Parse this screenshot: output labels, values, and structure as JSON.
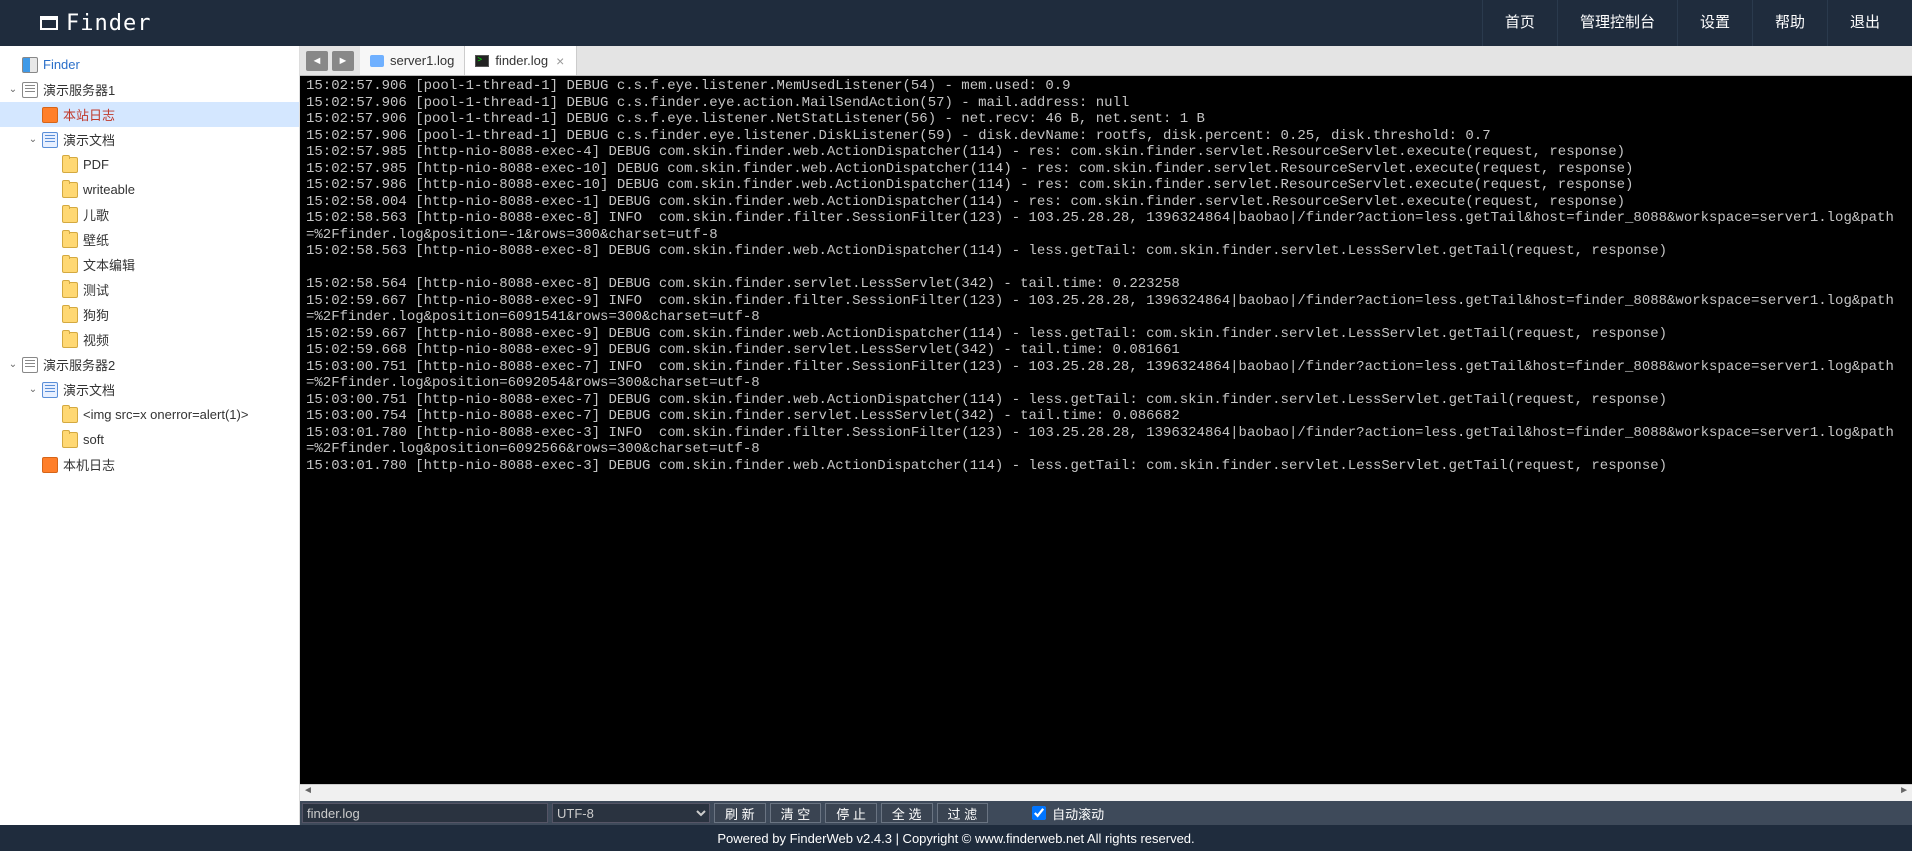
{
  "brand": "Finder",
  "nav": [
    "首页",
    "管理控制台",
    "设置",
    "帮助",
    "退出"
  ],
  "tree": [
    {
      "depth": 0,
      "toggle": "",
      "icon": "finder",
      "label": "Finder",
      "root": true
    },
    {
      "depth": 0,
      "toggle": "v",
      "icon": "page",
      "label": "演示服务器1"
    },
    {
      "depth": 1,
      "toggle": "",
      "icon": "log",
      "label": "本站日志",
      "active": true
    },
    {
      "depth": 1,
      "toggle": "v",
      "icon": "doc",
      "label": "演示文档"
    },
    {
      "depth": 2,
      "toggle": "",
      "icon": "folder",
      "label": "PDF"
    },
    {
      "depth": 2,
      "toggle": "",
      "icon": "folder",
      "label": "writeable"
    },
    {
      "depth": 2,
      "toggle": "",
      "icon": "folder",
      "label": "儿歌"
    },
    {
      "depth": 2,
      "toggle": "",
      "icon": "folder",
      "label": "壁纸"
    },
    {
      "depth": 2,
      "toggle": "",
      "icon": "folder",
      "label": "文本编辑"
    },
    {
      "depth": 2,
      "toggle": "",
      "icon": "folder",
      "label": "测试"
    },
    {
      "depth": 2,
      "toggle": "",
      "icon": "folder",
      "label": "狗狗"
    },
    {
      "depth": 2,
      "toggle": "",
      "icon": "folder",
      "label": "视频"
    },
    {
      "depth": 0,
      "toggle": "v",
      "icon": "page",
      "label": "演示服务器2"
    },
    {
      "depth": 1,
      "toggle": "v",
      "icon": "doc",
      "label": "演示文档"
    },
    {
      "depth": 2,
      "toggle": "",
      "icon": "folder",
      "label": "<img src=x onerror=alert(1)>"
    },
    {
      "depth": 2,
      "toggle": "",
      "icon": "folder",
      "label": "soft"
    },
    {
      "depth": 1,
      "toggle": "",
      "icon": "log",
      "label": "本机日志"
    }
  ],
  "tabs": [
    {
      "icon": "folder",
      "label": "server1.log",
      "close": false,
      "active": false
    },
    {
      "icon": "term",
      "label": "finder.log",
      "close": true,
      "active": true
    }
  ],
  "log_lines": [
    "15:02:57.906 [pool-1-thread-1] DEBUG c.s.f.eye.listener.MemUsedListener(54) - mem.used: 0.9",
    "15:02:57.906 [pool-1-thread-1] DEBUG c.s.finder.eye.action.MailSendAction(57) - mail.address: null",
    "15:02:57.906 [pool-1-thread-1] DEBUG c.s.f.eye.listener.NetStatListener(56) - net.recv: 46 B, net.sent: 1 B",
    "15:02:57.906 [pool-1-thread-1] DEBUG c.s.finder.eye.listener.DiskListener(59) - disk.devName: rootfs, disk.percent: 0.25, disk.threshold: 0.7",
    "15:02:57.985 [http-nio-8088-exec-4] DEBUG com.skin.finder.web.ActionDispatcher(114) - res: com.skin.finder.servlet.ResourceServlet.execute(request, response)",
    "15:02:57.985 [http-nio-8088-exec-10] DEBUG com.skin.finder.web.ActionDispatcher(114) - res: com.skin.finder.servlet.ResourceServlet.execute(request, response)",
    "15:02:57.986 [http-nio-8088-exec-10] DEBUG com.skin.finder.web.ActionDispatcher(114) - res: com.skin.finder.servlet.ResourceServlet.execute(request, response)",
    "15:02:58.004 [http-nio-8088-exec-1] DEBUG com.skin.finder.web.ActionDispatcher(114) - res: com.skin.finder.servlet.ResourceServlet.execute(request, response)",
    "15:02:58.563 [http-nio-8088-exec-8] INFO  com.skin.finder.filter.SessionFilter(123) - 103.25.28.28, 1396324864|baobao|/finder?action=less.getTail&host=finder_8088&workspace=server1.log&path=%2Ffinder.log&position=-1&rows=300&charset=utf-8",
    "15:02:58.563 [http-nio-8088-exec-8] DEBUG com.skin.finder.web.ActionDispatcher(114) - less.getTail: com.skin.finder.servlet.LessServlet.getTail(request, response)",
    "",
    "15:02:58.564 [http-nio-8088-exec-8] DEBUG com.skin.finder.servlet.LessServlet(342) - tail.time: 0.223258",
    "15:02:59.667 [http-nio-8088-exec-9] INFO  com.skin.finder.filter.SessionFilter(123) - 103.25.28.28, 1396324864|baobao|/finder?action=less.getTail&host=finder_8088&workspace=server1.log&path=%2Ffinder.log&position=6091541&rows=300&charset=utf-8",
    "15:02:59.667 [http-nio-8088-exec-9] DEBUG com.skin.finder.web.ActionDispatcher(114) - less.getTail: com.skin.finder.servlet.LessServlet.getTail(request, response)",
    "15:02:59.668 [http-nio-8088-exec-9] DEBUG com.skin.finder.servlet.LessServlet(342) - tail.time: 0.081661",
    "15:03:00.751 [http-nio-8088-exec-7] INFO  com.skin.finder.filter.SessionFilter(123) - 103.25.28.28, 1396324864|baobao|/finder?action=less.getTail&host=finder_8088&workspace=server1.log&path=%2Ffinder.log&position=6092054&rows=300&charset=utf-8",
    "15:03:00.751 [http-nio-8088-exec-7] DEBUG com.skin.finder.web.ActionDispatcher(114) - less.getTail: com.skin.finder.servlet.LessServlet.getTail(request, response)",
    "15:03:00.754 [http-nio-8088-exec-7] DEBUG com.skin.finder.servlet.LessServlet(342) - tail.time: 0.086682",
    "15:03:01.780 [http-nio-8088-exec-3] INFO  com.skin.finder.filter.SessionFilter(123) - 103.25.28.28, 1396324864|baobao|/finder?action=less.getTail&host=finder_8088&workspace=server1.log&path=%2Ffinder.log&position=6092566&rows=300&charset=utf-8",
    "15:03:01.780 [http-nio-8088-exec-3] DEBUG com.skin.finder.web.ActionDispatcher(114) - less.getTail: com.skin.finder.servlet.LessServlet.getTail(request, response)"
  ],
  "toolbar": {
    "filename": "finder.log",
    "charset": "UTF-8",
    "buttons": [
      "刷 新",
      "清 空",
      "停 止",
      "全 选",
      "过 滤"
    ],
    "autoscroll_label": "自动滚动",
    "autoscroll_checked": true
  },
  "footer": "Powered by FinderWeb v2.4.3 | Copyright © www.finderweb.net All rights reserved."
}
